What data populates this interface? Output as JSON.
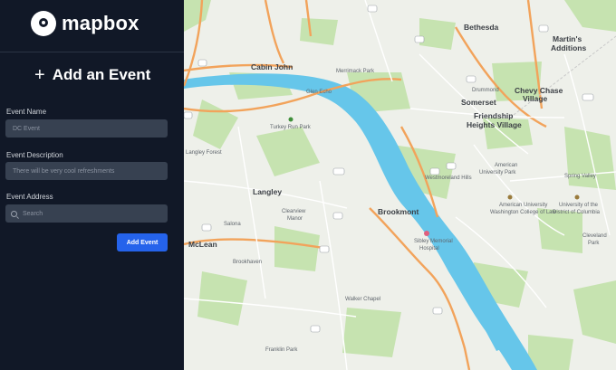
{
  "brand": {
    "name": "mapbox",
    "logo": "mapbox-logo-icon"
  },
  "form": {
    "title": "Add an Event",
    "title_icon": "plus-icon",
    "event_name": {
      "label": "Event Name",
      "placeholder": "DC Event"
    },
    "event_description": {
      "label": "Event Description",
      "placeholder": "There will be very cool refreshments"
    },
    "event_address": {
      "label": "Event Address",
      "placeholder": "Search",
      "icon": "search-icon"
    },
    "submit_label": "Add Event"
  },
  "map": {
    "places": {
      "bethesda": "Bethesda",
      "martins": "Martin's",
      "additions": "Additions",
      "cabin_john": "Cabin John",
      "merrimack": "Merrimack Park",
      "glen_echo": "Glen Echo",
      "drummond": "Drummond",
      "chevy_chase": "Chevy Chase",
      "village": "Village",
      "somerset": "Somerset",
      "friendship": "Friendship",
      "heights": "Heights Village",
      "turkey_run": "Turkey Run Park",
      "langley_forest": "Langley Forest",
      "langley": "Langley",
      "clearview": "Clearview",
      "manor": "Manor",
      "brookmont": "Brookmont",
      "sibley": "Sibley Memorial",
      "hospital": "Hospital",
      "salona": "Salona",
      "mclean": "McLean",
      "brookhaven": "Brookhaven",
      "walker_chapel": "Walker Chapel",
      "franklin_park": "Franklin Park",
      "american": "American",
      "university_park": "University Park",
      "westmoreland": "Westmoreland Hills",
      "spring_valley": "Spring Valley",
      "amer_univ": "American University",
      "washington_college": "Washington College of Law",
      "univ_dc": "University of the",
      "district_columbia": "District of Columbia",
      "cleveland": "Cleveland",
      "park": "Park"
    },
    "colors": {
      "water": "#66c6ea",
      "park": "#c6e3b0",
      "road": "#f2a35b",
      "land": "#eef0ea"
    }
  }
}
